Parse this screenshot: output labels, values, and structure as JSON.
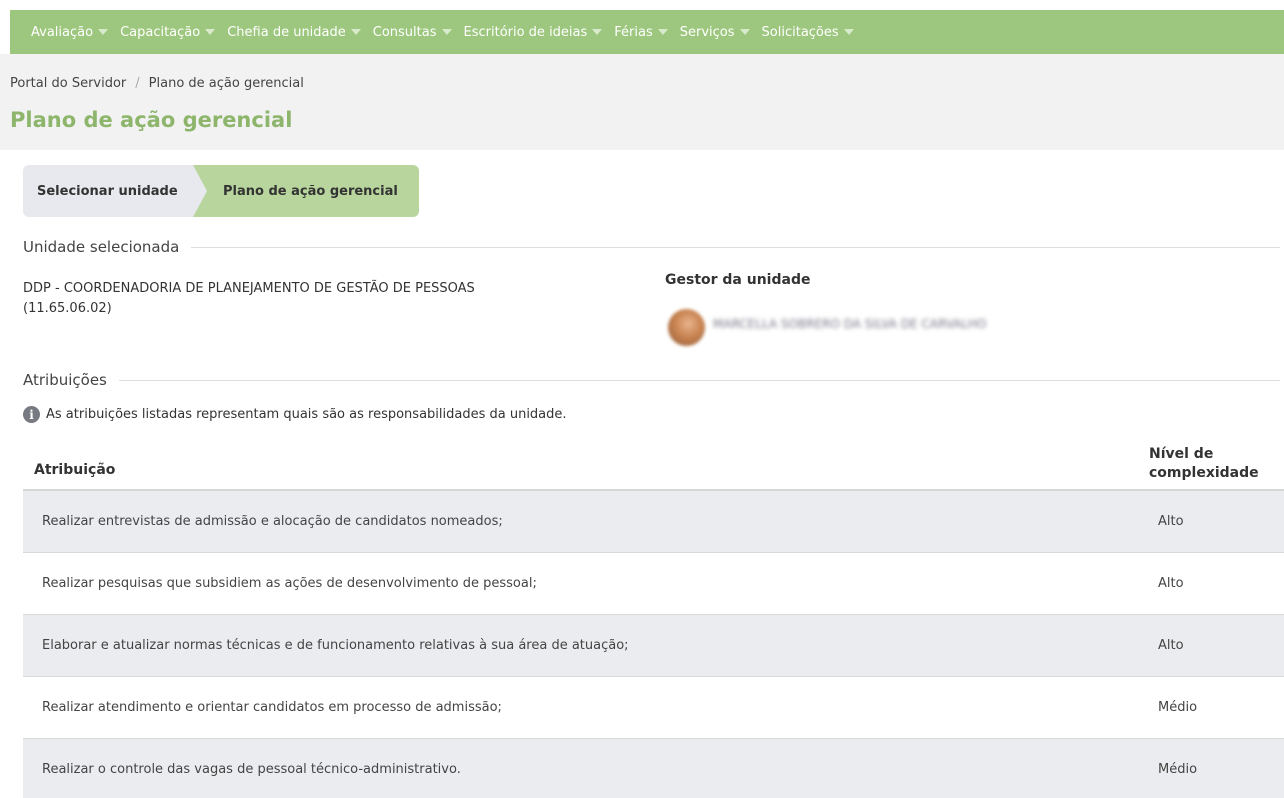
{
  "nav": {
    "items": [
      {
        "label": "Avaliação"
      },
      {
        "label": "Capacitação"
      },
      {
        "label": "Chefia de unidade"
      },
      {
        "label": "Consultas"
      },
      {
        "label": "Escritório de ideias"
      },
      {
        "label": "Férias"
      },
      {
        "label": "Serviços"
      },
      {
        "label": "Solicitações"
      }
    ]
  },
  "breadcrumb": {
    "root": "Portal do Servidor",
    "separator": "/",
    "current": "Plano de ação gerencial"
  },
  "page_title": "Plano de ação gerencial",
  "wizard": {
    "step1": "Selecionar unidade",
    "step2": "Plano de ação gerencial"
  },
  "unit_section": {
    "legend": "Unidade selecionada",
    "unit_name": "DDP - COORDENADORIA DE PLANEJAMENTO DE GESTÃO DE PESSOAS (11.65.06.02)",
    "gestor_label": "Gestor da unidade",
    "gestor_name": "MARCELLA SOBRERO DA SILVA DE CARVALHO"
  },
  "attributions": {
    "legend": "Atribuições",
    "info": "As atribuições listadas representam quais são as responsabilidades da unidade.",
    "headers": {
      "attribution": "Atribuição",
      "level": "Nível de complexidade"
    },
    "rows": [
      {
        "text": "Realizar entrevistas de admissão e alocação de candidatos nomeados;",
        "level": "Alto"
      },
      {
        "text": "Realizar pesquisas que subsidiem as ações de desenvolvimento de pessoal;",
        "level": "Alto"
      },
      {
        "text": "Elaborar e atualizar normas técnicas e de funcionamento relativas à sua área de atuação;",
        "level": "Alto"
      },
      {
        "text": "Realizar atendimento e orientar candidatos em processo de admissão;",
        "level": "Médio"
      },
      {
        "text": "Realizar o controle das vagas de pessoal técnico-administrativo.",
        "level": "Médio"
      }
    ]
  },
  "colors": {
    "nav_bg": "#9dc77e",
    "title": "#8db66c",
    "active_step": "#b7d59c"
  }
}
